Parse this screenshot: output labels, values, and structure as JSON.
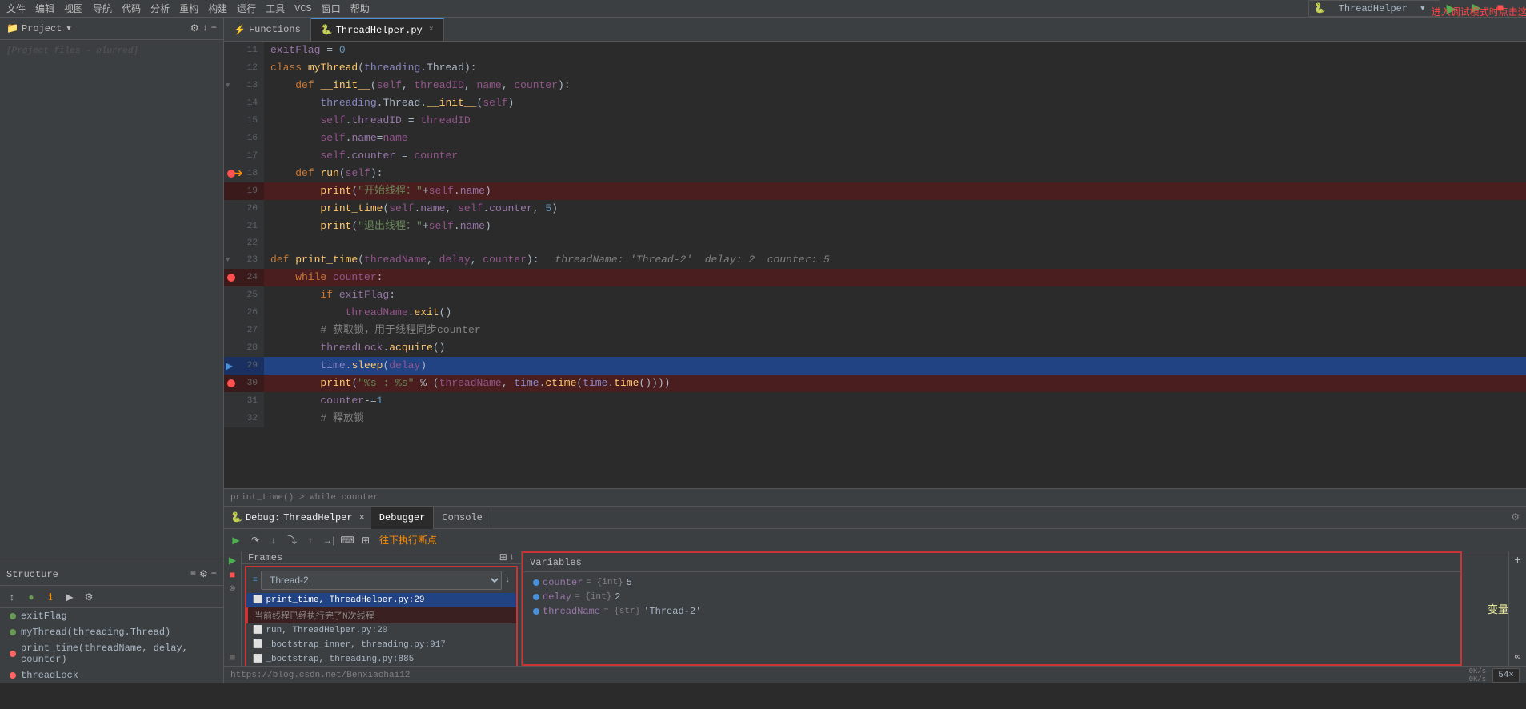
{
  "menubar": {
    "items": [
      "文件",
      "编辑",
      "视图",
      "导航",
      "代码",
      "分析",
      "重构",
      "构建",
      "运行",
      "工具",
      "VCS",
      "窗口",
      "帮助"
    ]
  },
  "toolbar": {
    "project_label": "Project",
    "run_config": "ThreadHelper",
    "run_icon": "▶",
    "stop_icon": "■",
    "debug_icon": "🐛"
  },
  "editor": {
    "active_tab": "ThreadHelper.py",
    "other_tab": "Functions",
    "breadcrumb": "print_time() > while counter",
    "lines": [
      {
        "num": 11,
        "content": "exitFlag = 0",
        "type": "normal"
      },
      {
        "num": 12,
        "content": "class myThread(threading.Thread):",
        "type": "class"
      },
      {
        "num": 13,
        "content": "    def __init__(self, threadID, name, counter):",
        "type": "def"
      },
      {
        "num": 14,
        "content": "        threading.Thread.__init__(self)",
        "type": "normal"
      },
      {
        "num": 15,
        "content": "        self.threadID = threadID",
        "type": "normal"
      },
      {
        "num": 16,
        "content": "        self.name=name",
        "type": "normal"
      },
      {
        "num": 17,
        "content": "        self.counter = counter",
        "type": "normal"
      },
      {
        "num": 18,
        "content": "    def run(self):",
        "type": "def",
        "breakpoint": true,
        "arrow": true
      },
      {
        "num": 19,
        "content": "        print(\"开始线程：\"+self.name)",
        "type": "normal",
        "highlight": "red"
      },
      {
        "num": 20,
        "content": "        print_time(self.name, self.counter, 5)",
        "type": "normal"
      },
      {
        "num": 21,
        "content": "        print(\"退出线程：\"+self.name)",
        "type": "normal"
      },
      {
        "num": 22,
        "content": "",
        "type": "empty"
      },
      {
        "num": 23,
        "content": "def print_time(threadName, delay, counter):    threadName: 'Thread-2'  delay: 2  counter: 5",
        "type": "def_hint"
      },
      {
        "num": 24,
        "content": "    while counter:",
        "type": "normal",
        "breakpoint": true,
        "highlight": "red"
      },
      {
        "num": 25,
        "content": "        if exitFlag:",
        "type": "normal"
      },
      {
        "num": 26,
        "content": "            threadName.exit()",
        "type": "normal"
      },
      {
        "num": 27,
        "content": "        # 获取锁，用于线程同步counter",
        "type": "comment"
      },
      {
        "num": 28,
        "content": "        threadLock.acquire()",
        "type": "normal"
      },
      {
        "num": 29,
        "content": "        time.sleep(delay)",
        "type": "normal",
        "highlight": "blue_current"
      },
      {
        "num": 30,
        "content": "        print(\"%s : %s\" % (threadName, time.ctime(time.time())))",
        "type": "normal",
        "breakpoint": true,
        "highlight": "red"
      },
      {
        "num": 31,
        "content": "        counter-=1",
        "type": "normal"
      },
      {
        "num": 32,
        "content": "        # 释放锁",
        "type": "comment_partial"
      }
    ]
  },
  "structure": {
    "title": "Structure",
    "items": [
      {
        "label": "exitFlag",
        "color": "green"
      },
      {
        "label": "myThread(threading.Thread)",
        "color": "green"
      },
      {
        "label": "print_time(threadName, delay, counter)",
        "color": "red"
      },
      {
        "label": "threadLock",
        "color": "red"
      }
    ]
  },
  "debug": {
    "title": "Debug:",
    "session_name": "ThreadHelper",
    "tabs": [
      "Debugger",
      "Console"
    ],
    "frames_title": "Frames",
    "thread_name": "Thread-2",
    "frame_items": [
      {
        "label": "print_time, ThreadHelper.py:29",
        "active": true
      },
      {
        "label": "当前线程已经执行完了N次线程",
        "active": false
      },
      {
        "label": "run, ThreadHelper.py:20",
        "active": false
      },
      {
        "label": "_bootstrap_inner, threading.py:917",
        "active": false
      },
      {
        "label": "_bootstrap, threading.py:885",
        "active": false
      }
    ],
    "variables_title": "Variables",
    "variables": [
      {
        "key": "counter",
        "type": "int",
        "value": "5"
      },
      {
        "key": "delay",
        "type": "int",
        "value": "2"
      },
      {
        "key": "threadName",
        "type": "str",
        "value": "'Thread-2'"
      }
    ],
    "var_annotation": "变量"
  },
  "annotations": {
    "top_right": "进入调试模式时点击这里",
    "debug_bottom": "往下执行断点"
  },
  "statusbar": {
    "url": "https://blog.csdn.net/Benxiaohai12",
    "network_up": "0K/s",
    "network_down": "0K/s",
    "speed": "54×"
  }
}
